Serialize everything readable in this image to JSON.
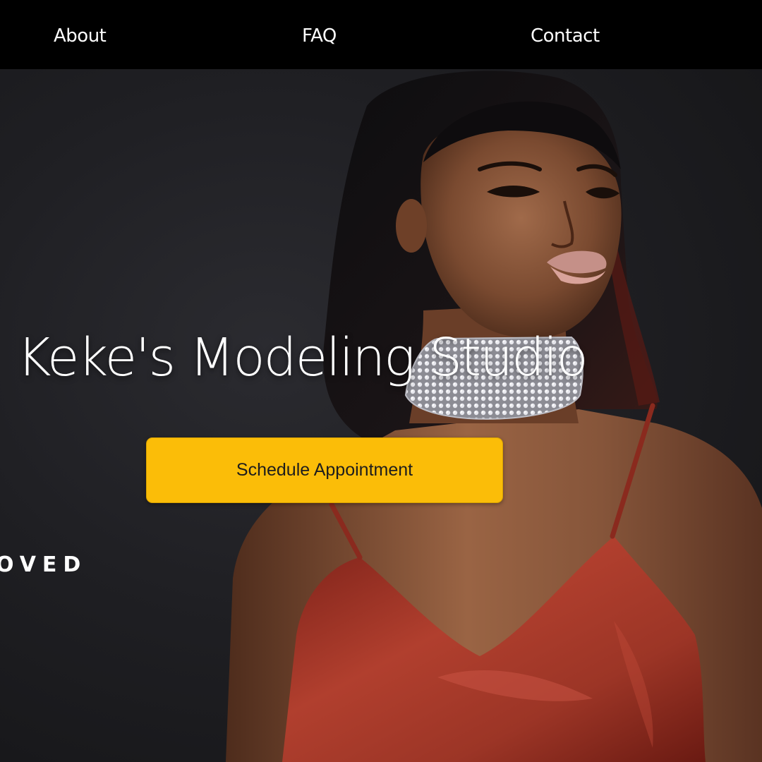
{
  "nav": {
    "items": [
      {
        "label": "About"
      },
      {
        "label": "FAQ"
      },
      {
        "label": "Contact"
      }
    ]
  },
  "hero": {
    "title": "Keke's Modeling Studio",
    "cta_label": "Schedule Appointment",
    "background_overlay_text": "OVED"
  },
  "colors": {
    "nav_background": "#000000",
    "hero_background": "#1f1f23",
    "cta_background": "#fbbd08",
    "text_primary": "#ffffff",
    "dress": "#a8372a"
  }
}
